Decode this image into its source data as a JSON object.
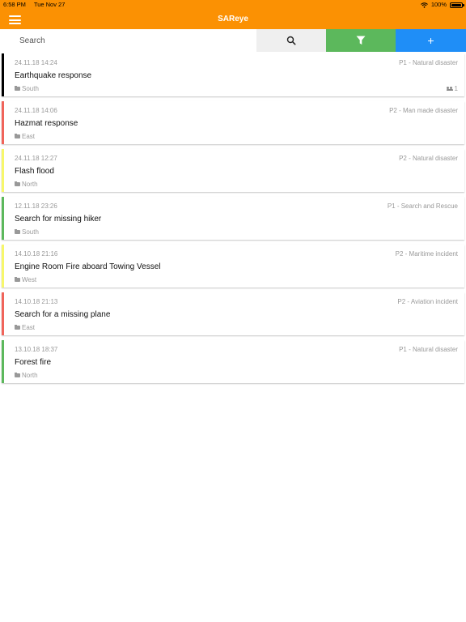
{
  "status_bar": {
    "time": "6:58 PM",
    "date": "Tue Nov 27",
    "battery": "100%"
  },
  "nav": {
    "title": "SAReye"
  },
  "search": {
    "placeholder": "Search",
    "add_label": "+"
  },
  "incidents": [
    {
      "date": "24.11.18 14:24",
      "category": "P1 - Natural disaster",
      "title": "Earthquake response",
      "region": "South",
      "members": "1",
      "color": "#000000"
    },
    {
      "date": "24.11.18 14:06",
      "category": "P2 - Man made disaster",
      "title": "Hazmat response",
      "region": "East",
      "members": "",
      "color": "#f0645a"
    },
    {
      "date": "24.11.18 12:27",
      "category": "P2 - Natural disaster",
      "title": "Flash flood",
      "region": "North",
      "members": "",
      "color": "#f7f76a"
    },
    {
      "date": "12.11.18 23:26",
      "category": "P1 - Search and Rescue",
      "title": "Search for missing hiker",
      "region": "South",
      "members": "",
      "color": "#5cb85c"
    },
    {
      "date": "14.10.18 21:16",
      "category": "P2 - Maritime incident",
      "title": "Engine Room Fire aboard Towing Vessel",
      "region": "West",
      "members": "",
      "color": "#f7f76a"
    },
    {
      "date": "14.10.18 21:13",
      "category": "P2 - Aviation incident",
      "title": "Search for a missing plane",
      "region": "East",
      "members": "",
      "color": "#f0645a"
    },
    {
      "date": "13.10.18 18:37",
      "category": "P1 - Natural disaster",
      "title": "Forest fire",
      "region": "North",
      "members": "",
      "color": "#5cb85c"
    }
  ]
}
